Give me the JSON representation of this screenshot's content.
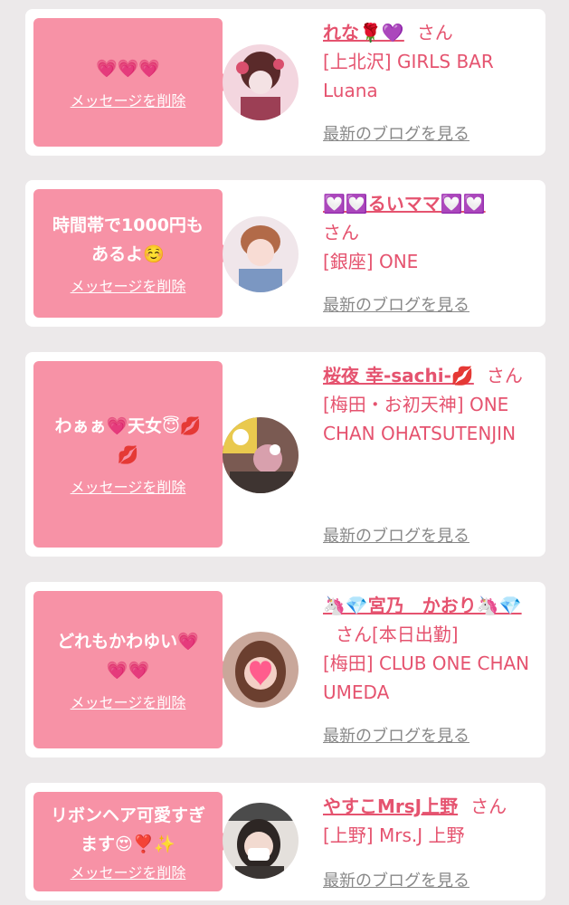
{
  "cards": [
    {
      "message": "💗💗💗",
      "delete_label": "メッセージを削除",
      "name": "れな🌹💜",
      "suffix": "さん",
      "shop": "[上北沢] GIRLS BAR Luana",
      "blog_label": "最新のブログを見る"
    },
    {
      "message": "時間帯で1000円もあるよ☺️",
      "delete_label": "メッセージを削除",
      "name": "💟💟るいママ💟💟",
      "suffix": "さん",
      "shop": "[銀座] ONE",
      "blog_label": "最新のブログを見る"
    },
    {
      "message": "わぁぁ💗天女😇💋💋",
      "delete_label": "メッセージを削除",
      "name": "桜夜 幸-sachi-💋",
      "suffix": "さん",
      "shop": "[梅田・お初天神] ONE CHAN OHATSUTENJIN",
      "blog_label": "最新のブログを見る"
    },
    {
      "message": "どれもかわゆい💗💗💗",
      "delete_label": "メッセージを削除",
      "name": "🦄💎宮乃　かおり🦄💎",
      "suffix": "さん[本日出勤]",
      "shop": "[梅田] CLUB ONE CHAN UMEDA",
      "blog_label": "最新のブログを見る"
    },
    {
      "message": "リボンヘア可愛すぎます😍❣️✨",
      "delete_label": "メッセージを削除",
      "name": "やすこMrsJ上野",
      "suffix": "さん",
      "shop": "[上野] Mrs.J 上野",
      "blog_label": "最新のブログを見る"
    }
  ],
  "colors": {
    "accent": "#e5536f",
    "bubble": "#f792a6",
    "background": "#ece9ea",
    "link_gray": "#888888"
  }
}
